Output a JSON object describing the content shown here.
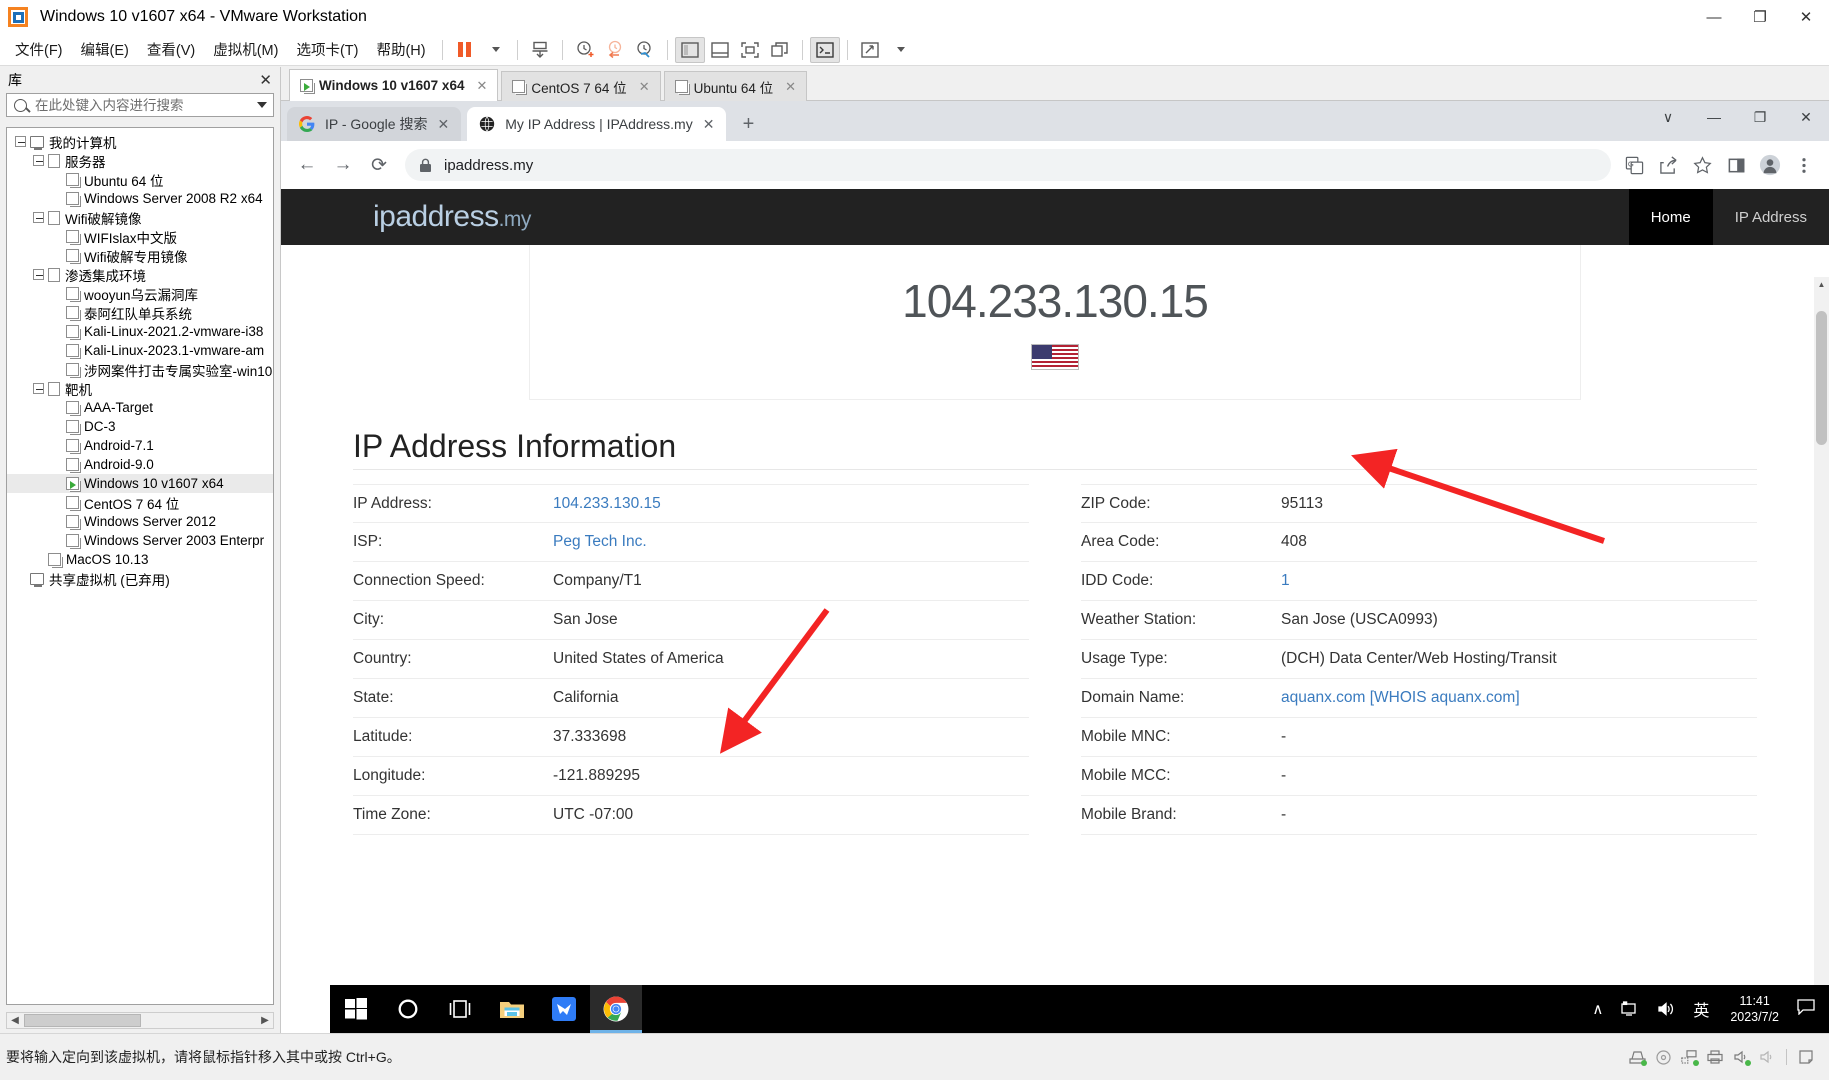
{
  "app": {
    "title": "Windows 10 v1607 x64 - VMware Workstation",
    "logo_icon": "vmware-logo-icon",
    "window_controls": {
      "minimize": "—",
      "maximize": "❐",
      "close": "✕"
    },
    "menu": [
      {
        "label": "文件(F)",
        "name": "menu-file"
      },
      {
        "label": "编辑(E)",
        "name": "menu-edit"
      },
      {
        "label": "查看(V)",
        "name": "menu-view"
      },
      {
        "label": "虚拟机(M)",
        "name": "menu-vm"
      },
      {
        "label": "选项卡(T)",
        "name": "menu-tabs"
      },
      {
        "label": "帮助(H)",
        "name": "menu-help"
      }
    ],
    "toolbar_icons": [
      "pause-icon",
      "dropdown-caret-icon",
      "send-ctrl-alt-del-icon",
      "snapshot-take-icon",
      "snapshot-revert-icon",
      "snapshot-manager-icon",
      "show-library-icon",
      "show-thumbnail-bar-icon",
      "full-screen-icon",
      "unity-mode-icon",
      "console-icon",
      "stretch-icon"
    ]
  },
  "library": {
    "header": "库",
    "close_label": "✕",
    "search": {
      "placeholder": "在此处键入内容进行搜索",
      "value": "",
      "icon": "search-icon"
    },
    "tree": [
      {
        "label": "我的计算机",
        "depth": 0,
        "type": "host",
        "expander": true
      },
      {
        "label": "服务器",
        "depth": 1,
        "type": "folder",
        "expander": true
      },
      {
        "label": "Ubuntu 64 位",
        "depth": 2,
        "type": "vm"
      },
      {
        "label": "Windows Server 2008 R2 x64",
        "depth": 2,
        "type": "vm"
      },
      {
        "label": "Wifi破解镜像",
        "depth": 1,
        "type": "folder",
        "expander": true
      },
      {
        "label": "WIFIslax中文版",
        "depth": 2,
        "type": "vm"
      },
      {
        "label": "Wifi破解专用镜像",
        "depth": 2,
        "type": "vm"
      },
      {
        "label": "渗透集成环境",
        "depth": 1,
        "type": "folder",
        "expander": true
      },
      {
        "label": "wooyun乌云漏洞库",
        "depth": 2,
        "type": "vm"
      },
      {
        "label": "泰阿红队单兵系统",
        "depth": 2,
        "type": "vm"
      },
      {
        "label": "Kali-Linux-2021.2-vmware-i38",
        "depth": 2,
        "type": "vm"
      },
      {
        "label": "Kali-Linux-2023.1-vmware-am",
        "depth": 2,
        "type": "vm"
      },
      {
        "label": "涉网案件打击专属实验室-win10",
        "depth": 2,
        "type": "vm"
      },
      {
        "label": "靶机",
        "depth": 1,
        "type": "folder",
        "expander": true
      },
      {
        "label": "AAA-Target",
        "depth": 2,
        "type": "vm"
      },
      {
        "label": "DC-3",
        "depth": 2,
        "type": "vm"
      },
      {
        "label": "Android-7.1",
        "depth": 2,
        "type": "vm"
      },
      {
        "label": "Android-9.0",
        "depth": 2,
        "type": "vm"
      },
      {
        "label": "Windows 10 v1607 x64",
        "depth": 2,
        "type": "vm-running",
        "selected": true
      },
      {
        "label": "CentOS 7 64 位",
        "depth": 2,
        "type": "vm"
      },
      {
        "label": "Windows Server 2012",
        "depth": 2,
        "type": "vm"
      },
      {
        "label": "Windows Server 2003 Enterpr",
        "depth": 2,
        "type": "vm"
      },
      {
        "label": "MacOS 10.13",
        "depth": 1,
        "type": "vm"
      },
      {
        "label": "共享虚拟机 (已弃用)",
        "depth": 0,
        "type": "host"
      }
    ]
  },
  "vm_tabs": [
    {
      "label": "Windows 10 v1607 x64",
      "active": true,
      "running": true,
      "close": "✕"
    },
    {
      "label": "CentOS 7 64 位",
      "active": false,
      "running": false,
      "close": "✕"
    },
    {
      "label": "Ubuntu 64 位",
      "active": false,
      "running": false,
      "close": "✕"
    }
  ],
  "browser": {
    "tabs": [
      {
        "label": "IP - Google 搜索",
        "active": false,
        "favicon": "google-icon",
        "close": "✕"
      },
      {
        "label": "My IP Address | IPAddress.my",
        "active": true,
        "favicon": "globe-icon",
        "close": "✕"
      }
    ],
    "new_tab_label": "+",
    "window_controls": {
      "collapse": "∨",
      "minimize": "—",
      "restore": "❐",
      "close": "✕"
    },
    "nav": {
      "back": "←",
      "forward": "→",
      "reload": "⟳"
    },
    "omnibox": {
      "url": "ipaddress.my",
      "lock_icon": "lock-icon"
    },
    "toolbar_icons": [
      "translate-icon",
      "share-icon",
      "bookmark-star-icon",
      "side-panel-icon",
      "profile-avatar-icon",
      "more-menu-icon"
    ]
  },
  "site": {
    "brand": "ipaddress",
    "brand_suffix": ".my",
    "nav": [
      {
        "label": "Home",
        "active": true
      },
      {
        "label": "IP Address",
        "active": false
      }
    ],
    "hero_ip": "104.233.130.15",
    "flag_icon": "us-flag-icon",
    "section_title": "IP Address Information",
    "left_rows": [
      {
        "key": "IP Address:",
        "value": "104.233.130.15",
        "link": true
      },
      {
        "key": "ISP:",
        "value": "Peg Tech Inc.",
        "link": true
      },
      {
        "key": "Connection Speed:",
        "value": "Company/T1",
        "link": false
      },
      {
        "key": "City:",
        "value": "San Jose",
        "link": false
      },
      {
        "key": "Country:",
        "value": "United States of America",
        "link": false
      },
      {
        "key": "State:",
        "value": "California",
        "link": false
      },
      {
        "key": "Latitude:",
        "value": "37.333698",
        "link": false
      },
      {
        "key": "Longitude:",
        "value": "-121.889295",
        "link": false
      },
      {
        "key": "Time Zone:",
        "value": "UTC -07:00",
        "link": false
      }
    ],
    "right_rows": [
      {
        "key": "ZIP Code:",
        "value": "95113",
        "link": false
      },
      {
        "key": "Area Code:",
        "value": "408",
        "link": false
      },
      {
        "key": "IDD Code:",
        "value": "1",
        "link": true
      },
      {
        "key": "Weather Station:",
        "value": "San Jose (USCA0993)",
        "link": false
      },
      {
        "key": "Usage Type:",
        "value": "(DCH) Data Center/Web Hosting/Transit",
        "link": false
      },
      {
        "key": "Domain Name:",
        "value": "aquanx.com [WHOIS aquanx.com]",
        "link": true
      },
      {
        "key": "Mobile MNC:",
        "value": "-",
        "link": false
      },
      {
        "key": "Mobile MCC:",
        "value": "-",
        "link": false
      },
      {
        "key": "Mobile Brand:",
        "value": "-",
        "link": false
      }
    ],
    "annotation_color": "#f32424"
  },
  "taskbar": {
    "buttons": [
      "start-icon",
      "cortana-search-icon",
      "task-view-icon",
      "file-explorer-icon",
      "foxmail-icon",
      "chrome-icon"
    ],
    "tray": {
      "chevron": "∧",
      "network_icon": "network-icon",
      "volume_icon": "volume-icon",
      "ime": "英"
    },
    "clock_time": "11:41",
    "clock_date": "2023/7/2",
    "notification_icon": "action-center-icon"
  },
  "status_bar": {
    "message": "要将输入定向到该虚拟机，请将鼠标指针移入其中或按 Ctrl+G。",
    "icons": [
      "harddisk-icon",
      "cd-icon",
      "network-adapter-icon",
      "printer-icon",
      "sound-icon",
      "speaker-icon",
      "note-icon"
    ]
  }
}
